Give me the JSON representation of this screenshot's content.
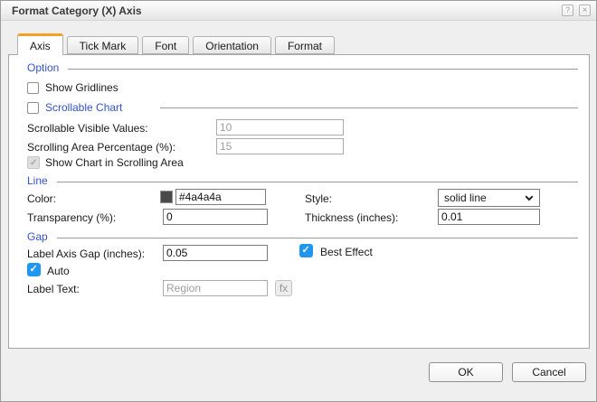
{
  "window": {
    "title": "Format Category (X) Axis",
    "help_icon": "?",
    "close_icon": "×"
  },
  "tabs": [
    {
      "label": "Axis",
      "active": true
    },
    {
      "label": "Tick Mark",
      "active": false
    },
    {
      "label": "Font",
      "active": false
    },
    {
      "label": "Orientation",
      "active": false
    },
    {
      "label": "Format",
      "active": false
    }
  ],
  "option_section": {
    "header": "Option",
    "show_gridlines": {
      "label": "Show Gridlines",
      "checked": false
    },
    "scrollable_chart": {
      "label": "Scrollable Chart",
      "checked": false
    },
    "scrollable_visible_values": {
      "label": "Scrollable Visible Values:",
      "value": "10",
      "disabled": true
    },
    "scrolling_area_percentage": {
      "label": "Scrolling Area Percentage (%):",
      "value": "15",
      "disabled": true
    },
    "show_chart_in_scrolling_area": {
      "label": "Show Chart in Scrolling Area",
      "checked": true,
      "disabled": true
    }
  },
  "line_section": {
    "header": "Line",
    "color": {
      "label": "Color:",
      "value": "#4a4a4a",
      "swatch_color": "#4a4a4a"
    },
    "style": {
      "label": "Style:",
      "value": "solid line"
    },
    "transparency": {
      "label": "Transparency (%):",
      "value": "0"
    },
    "thickness": {
      "label": "Thickness (inches):",
      "value": "0.01"
    }
  },
  "gap_section": {
    "header": "Gap",
    "label_axis_gap": {
      "label": "Label Axis Gap (inches):",
      "value": "0.05"
    },
    "best_effect": {
      "label": "Best Effect",
      "checked": true
    },
    "auto": {
      "label": "Auto",
      "checked": true
    },
    "label_text": {
      "label": "Label Text:",
      "value": "Region",
      "disabled": true
    },
    "fx_button": "fx"
  },
  "footer": {
    "ok": "OK",
    "cancel": "Cancel"
  },
  "colors": {
    "section_header_blue": "#3353cb",
    "active_tab_accent": "#f2a227",
    "checkbox_checked_blue": "#2096f3",
    "line_color_swatch": "#4a4a4a"
  }
}
